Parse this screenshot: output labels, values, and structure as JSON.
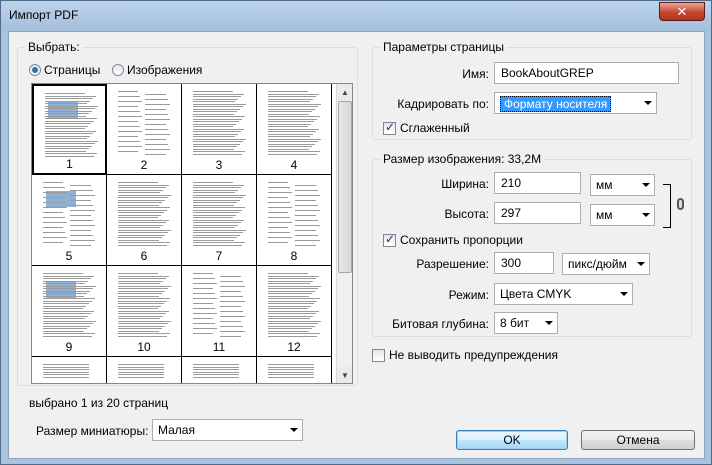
{
  "window": {
    "title": "Импорт PDF",
    "close_symbol": "✕"
  },
  "select": {
    "group_title": "Выбрать:",
    "options": [
      {
        "label": "Страницы",
        "selected": true
      },
      {
        "label": "Изображения",
        "selected": false
      }
    ],
    "pages": [
      "1",
      "2",
      "3",
      "4",
      "5",
      "6",
      "7",
      "8",
      "9",
      "10",
      "11",
      "12"
    ],
    "selected_page": "1",
    "status": "выбрано 1 из 20 страниц",
    "thumb_size_label": "Размер миниатюры:",
    "thumb_size_value": "Малая"
  },
  "page_params": {
    "group_title": "Параметры страницы",
    "name_label": "Имя:",
    "name_value": "BookAboutGREP",
    "crop_label": "Кадрировать по:",
    "crop_value": "Формату носителя",
    "smooth_label": "Сглаженный",
    "smooth_checked": true
  },
  "image_size": {
    "group_title": "Размер изображения: 33,2M",
    "width_label": "Ширина:",
    "width_value": "210",
    "width_unit": "мм",
    "height_label": "Высота:",
    "height_value": "297",
    "height_unit": "мм",
    "constrain_label": "Сохранить пропорции",
    "constrain_checked": true,
    "resolution_label": "Разрешение:",
    "resolution_value": "300",
    "resolution_unit": "пикс/дюйм",
    "mode_label": "Режим:",
    "mode_value": "Цвета CMYK",
    "depth_label": "Битовая глубина:",
    "depth_value": "8 бит"
  },
  "suppress_warnings": {
    "label": "Не выводить предупреждения",
    "checked": false
  },
  "buttons": {
    "ok": "OK",
    "cancel": "Отмена"
  },
  "colors": {
    "titlebar": "#a9c3de",
    "selection": "#3399ff",
    "close": "#c4462e"
  }
}
